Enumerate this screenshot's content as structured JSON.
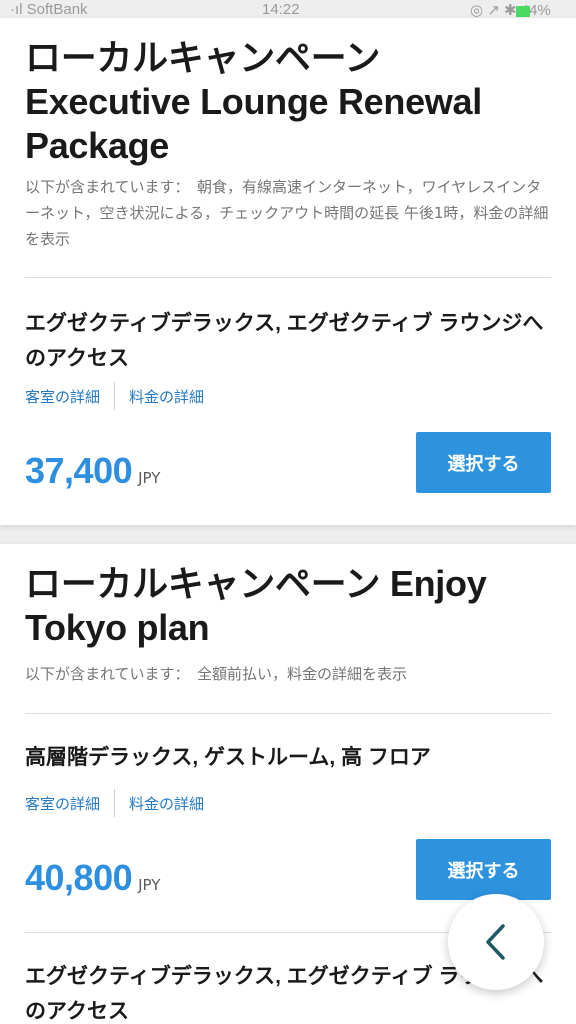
{
  "status_bar": {
    "carrier": "·ıl SoftBank",
    "time": "14:22",
    "battery": "◎ ↗ ✱ 44%"
  },
  "plans": [
    {
      "title": "ローカルキャンペーン Executive Lounge Renewal Package",
      "description": "以下が含まれています：　朝食，有線高速インターネット，ワイヤレスインターネット，空き状況による，チェックアウト時間の延長 午後1時，料金の詳細を表示",
      "rooms": [
        {
          "name": "エグゼクティブデラックス, エグゼクティブ ラウンジへのアクセス",
          "room_details_link": "客室の詳細",
          "rate_details_link": "料金の詳細",
          "price": "37,400",
          "currency": "JPY",
          "select_label": "選択する"
        }
      ]
    },
    {
      "title": "ローカルキャンペーン Enjoy Tokyo plan",
      "description": "以下が含まれています：　全額前払い，料金の詳細を表示",
      "rooms": [
        {
          "name": "高層階デラックス, ゲストルーム, 高 フロア",
          "room_details_link": "客室の詳細",
          "rate_details_link": "料金の詳細",
          "price": "40,800",
          "currency": "JPY",
          "select_label": "選択する"
        },
        {
          "name": "エグゼクティブデラックス, エグゼクティブ ラウンジへのアクセス"
        }
      ]
    }
  ],
  "fab": {
    "icon": "chevron-left-icon",
    "color": "#1e5a66"
  },
  "colors": {
    "accent": "#2d93df",
    "price": "#2d8fe0",
    "link": "#2479c0"
  }
}
